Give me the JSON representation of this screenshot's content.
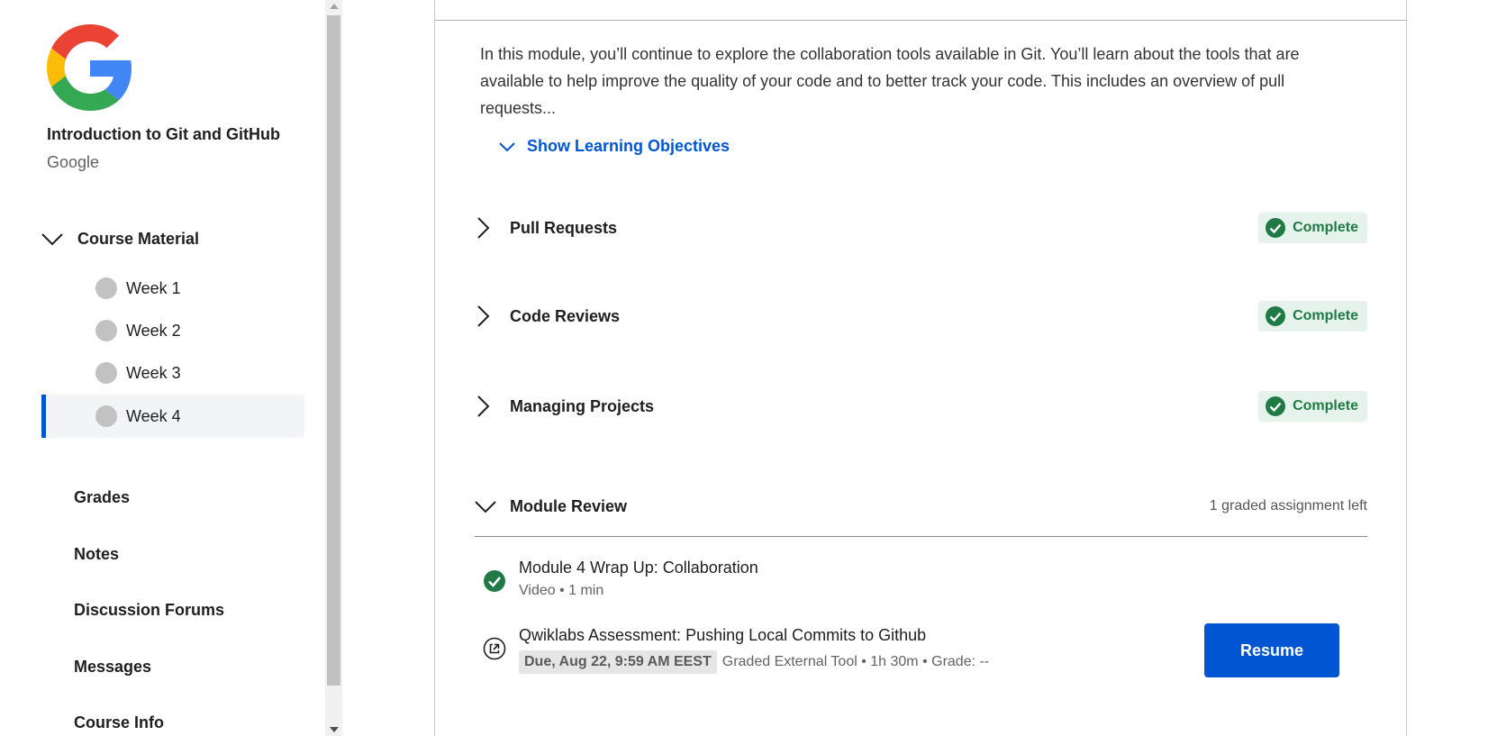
{
  "course": {
    "title": "Introduction to Git and GitHub",
    "organization": "Google",
    "logo_icon": "google-g-logo"
  },
  "sidebar": {
    "section_label": "Course Material",
    "weeks": [
      {
        "label": "Week 1",
        "active": false
      },
      {
        "label": "Week 2",
        "active": false
      },
      {
        "label": "Week 3",
        "active": false
      },
      {
        "label": "Week 4",
        "active": true
      }
    ],
    "links": [
      "Grades",
      "Notes",
      "Discussion Forums",
      "Messages",
      "Course Info"
    ]
  },
  "module": {
    "description": "In this module, you’ll continue to explore the collaboration tools available in Git. You’ll learn about the tools that are available to help improve the quality of your code and to better track your code. This includes an overview of pull requests...",
    "objectives_label": "Show Learning Objectives",
    "lessons": [
      {
        "title": "Pull Requests",
        "status": "Complete"
      },
      {
        "title": "Code Reviews",
        "status": "Complete"
      },
      {
        "title": "Managing Projects",
        "status": "Complete"
      }
    ],
    "review": {
      "title": "Module Review",
      "remaining": "1 graded assignment left",
      "items": [
        {
          "title": "Module 4 Wrap Up: Collaboration",
          "meta": "Video • 1 min",
          "icon": "check-circle-icon"
        },
        {
          "title": "Qwiklabs Assessment: Pushing Local Commits to Github",
          "due": "Due, Aug 22, 9:59 AM EEST",
          "meta": "Graded External Tool • 1h 30m • Grade: --",
          "icon": "external-link-icon"
        }
      ],
      "resume_label": "Resume"
    }
  },
  "colors": {
    "accent": "#0056d2",
    "complete_bg": "#e6f3ec",
    "complete_text": "#1f7a45"
  }
}
